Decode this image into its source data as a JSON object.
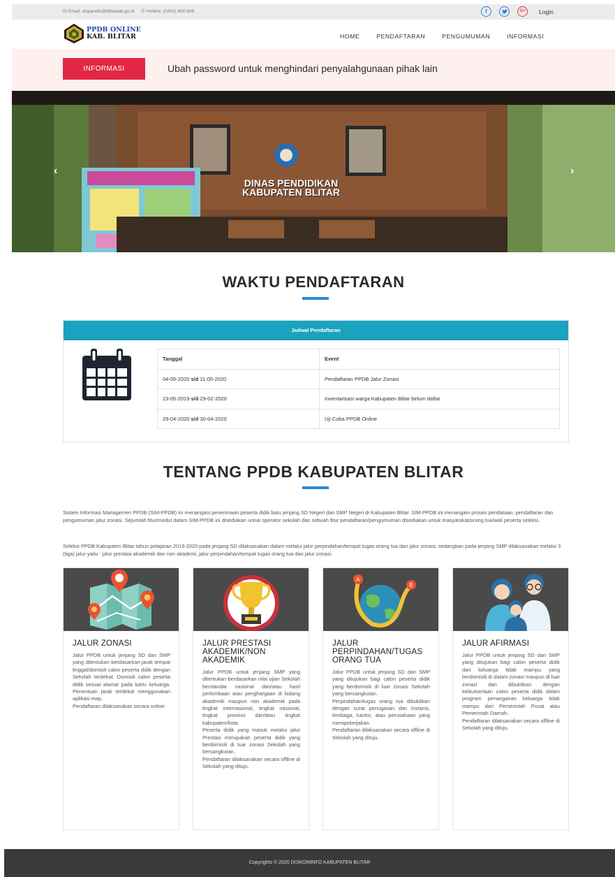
{
  "topbar": {
    "email": "Email: dispendik@blitarkab.go.id",
    "hotline": "Hotline: (0342) 800 608",
    "login": "Login"
  },
  "brand": {
    "line1": "PPDB ONLINE",
    "line2": "KAB. BLITAR"
  },
  "nav": [
    "HOME",
    "PENDAFTARAN",
    "PENGUMUMAN",
    "INFORMASI"
  ],
  "info": {
    "badge": "INFORMASI",
    "message": "Ubah password untuk menghindari penyalahgunaan pihak lain"
  },
  "hero": {
    "caption_line1": "DINAS PENDIDIKAN",
    "caption_line2": "KABUPATEN BLITAR"
  },
  "schedule": {
    "title": "WAKTU PENDAFTARAN",
    "panel_title": "Jadwal Pendaftaran",
    "columns": [
      "Tanggal",
      "Event"
    ],
    "rows": [
      {
        "start": "04-05-2020",
        "sd": "s/d",
        "end": "11-05-2020",
        "event": "Pendaftaran PPDB Jalur Zonasi"
      },
      {
        "start": "23-05-2019",
        "sd": "s/d",
        "end": "29-02-2020",
        "event": "Inventarisasi warga Kabupaten Blitar belum daftar"
      },
      {
        "start": "29-04-2020",
        "sd": "s/d",
        "end": "30-04-2020",
        "event": "Uji Coba PPDB Online"
      }
    ]
  },
  "about": {
    "title": "TENTANG PPDB KABUPATEN BLITAR",
    "p1": "Sistem Informasi Managemen PPDB (SIM-PPDB) ini menangani penerimaan peserta didik baru jenjang SD Negeri dan SMP Negeri di Kabupaten Blitar. SIM-PPDB ini menangani proses pendataan, pendaftaran dan pengumuman jalur zonasi. Sejumlah fitur/modul dalam SIM-PPDB ini disediakan untuk operator sekolah dan sebuah fitur pendaftaran/pengumuman disediakan untuk masyarakat/orang tua/wali peserta seleksi.",
    "p2": "Seleksi PPDB Kabupaten Blitar tahun pelajaran 2019-2020 pada jenjang SD dilaksanakan dalam melalui jalur perpindahan/tempat tugas orang tua dan jalur zonasi, sedangkan pada jenjang SMP dilaksanakan melalui 3 (tiga) jalur yaitu : jalur prestasi akademik dan non akademi, jalur perpindahan/tempat tugas orang tua dan jalur zonasi."
  },
  "cards": [
    {
      "title": "JALUR ZONASI",
      "icon": "map-pin-icon",
      "paragraphs": [
        "Jalur PPDB untuk jenjang SD dan SMP yang ditentukan berdasarkan jarak tempat tinggal/domisili calon peserta didik dengan Sekolah terdekat. Domisili calon peserta didik sesuai alamat pada kartu keluarga. Penentuan jarak terdekat menggunakan aplikasi map.",
        "Pendaftaran dilaksanakan secara online."
      ]
    },
    {
      "title": "JALUR PRESTASI AKADEMIK/NON AKADEMIK",
      "icon": "trophy-icon",
      "paragraphs": [
        "Jalur PPDB untuk jenjang SMP yang ditentukan berdasarkan nilai ujian Sekolah berstandar nasional dan/atau hasil perlombaan atau penghargaan di bidang akademik maupun non akademik pada tingkat internasional, tingkat nasional, tingkat provinsi dan/atau tingkat kabupaten/kota.",
        "Peserta didik yang masuk melalui jalur Prestasi merupakan peserta didik yang berdomisili di luar zonasi Sekolah yang bersangkutan.",
        "Pendaftaran dilaksanakan secara offline di Sekolah yang dituju."
      ]
    },
    {
      "title": "JALUR PERPINDAHAN/TUGAS ORANG TUA",
      "icon": "globe-route-icon",
      "paragraphs": [
        "Jalur PPDB untuk jenjang SD dan SMP yang ditujukan bagi calon peserta didik yang berdomisili di luar zonasi Sekolah yang bersangkutan.",
        "Perpindahan/tugas orang tua dibuktikan dengan surat penugasan dan instansi, lembaga, kantor, atau perusahaan yang mempekerjakan.",
        "Pendaftaran dilaksanakan secara offline di Sekolah yang dituju."
      ]
    },
    {
      "title": "JALUR AFIRMASI",
      "icon": "family-icon",
      "paragraphs": [
        "Jalur PPDB untuk jenjang SD dan SMP yang ditujukan bagi calon peserta didik dari keluarga tidak mampu yang berdomisili di dalam zonasi maupun di luar zonasi dan dibuktikan dengan keikutsertaan calon peserta didik dalam program penanganan keluarga tidak mampu dari Pemerintah Pusat atau Pemerintah Daerah.",
        "Pendaftaran dilaksanakan secara offline di Sekolah yang dituju."
      ]
    }
  ],
  "footer": "Copyrights © 2020 DISKOMINFO KABUPATEN BLITAR",
  "colors": {
    "accent_blue": "#2b8ad6",
    "badge_red": "#e32845",
    "panel_teal": "#1aa3bf",
    "footer_bg": "#3a3a3a"
  }
}
